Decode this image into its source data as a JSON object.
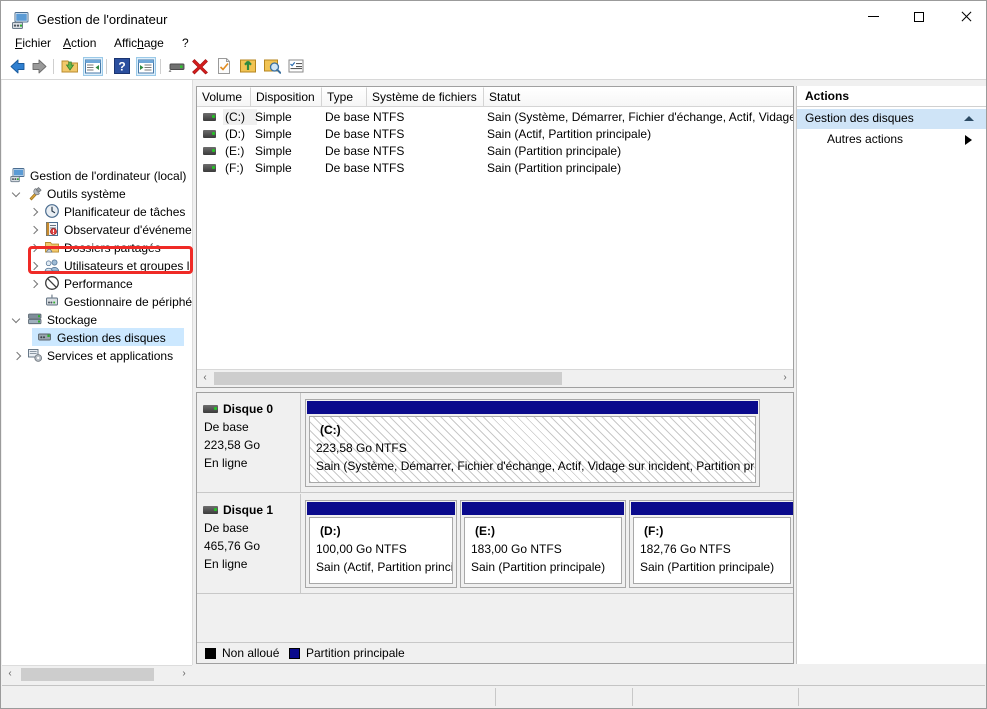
{
  "window": {
    "title": "Gestion de l'ordinateur",
    "icon": "computer-management-icon",
    "minimize": "—",
    "maximize": "□",
    "close": "✕"
  },
  "menubar": {
    "items": [
      {
        "label": "Fichier",
        "accel": "F"
      },
      {
        "label": "Action",
        "accel": "A"
      },
      {
        "label": "Affichage",
        "accel": "h"
      },
      {
        "label": "?",
        "accel": "?"
      }
    ]
  },
  "toolbar": {
    "buttons": [
      {
        "name": "back-icon",
        "tip": "Précédent"
      },
      {
        "name": "forward-icon",
        "tip": "Suivant"
      },
      {
        "name": "up-folder-icon",
        "tip": "Remonter d'un niveau"
      },
      {
        "name": "show-hide-console-tree-icon",
        "tip": "Afficher/Masquer l'arborescence"
      },
      {
        "name": "help-icon",
        "tip": "Aide"
      },
      {
        "name": "show-action-pane-icon",
        "tip": "Afficher le volet Actions"
      },
      {
        "name": "disk-icon",
        "tip": "Disque"
      },
      {
        "name": "delete-red-x-icon",
        "tip": "Supprimer"
      },
      {
        "name": "properties-icon",
        "tip": "Propriétés"
      },
      {
        "name": "export-list-icon",
        "tip": "Exporter la liste"
      },
      {
        "name": "scan-icon",
        "tip": "Analyser"
      },
      {
        "name": "task-list-icon",
        "tip": "Liste des tâches"
      }
    ]
  },
  "tree": {
    "root": "Gestion de l'ordinateur (local)",
    "nodes": [
      {
        "label": "Gestion de l'ordinateur (local)",
        "level": 0,
        "icon": "computer-icon",
        "expander": "none",
        "selected": false
      },
      {
        "label": "Outils système",
        "level": 1,
        "icon": "tools-icon",
        "expander": "open",
        "selected": false
      },
      {
        "label": "Planificateur de tâches",
        "level": 2,
        "icon": "clock-icon",
        "expander": "closed",
        "selected": false
      },
      {
        "label": "Observateur d'événeme",
        "level": 2,
        "icon": "event-viewer-icon",
        "expander": "closed",
        "selected": false
      },
      {
        "label": "Dossiers partagés",
        "level": 2,
        "icon": "shared-folder-icon",
        "expander": "closed",
        "selected": false
      },
      {
        "label": "Utilisateurs et groupes l",
        "level": 2,
        "icon": "users-groups-icon",
        "expander": "closed",
        "selected": false
      },
      {
        "label": "Performance",
        "level": 2,
        "icon": "performance-icon",
        "expander": "closed",
        "selected": false
      },
      {
        "label": "Gestionnaire de périphé",
        "level": 2,
        "icon": "device-manager-icon",
        "expander": "none",
        "selected": false
      },
      {
        "label": "Stockage",
        "level": 1,
        "icon": "storage-icon",
        "expander": "open",
        "selected": false
      },
      {
        "label": "Gestion des disques",
        "level": 2,
        "icon": "disk-management-icon",
        "expander": "none",
        "selected": true
      },
      {
        "label": "Services et applications",
        "level": 1,
        "icon": "services-icon",
        "expander": "closed",
        "selected": false
      }
    ]
  },
  "volume_list": {
    "columns": [
      "Volume",
      "Disposition",
      "Type",
      "Système de fichiers",
      "Statut"
    ],
    "rows": [
      {
        "volume": "(C:)",
        "disposition": "Simple",
        "type": "De base",
        "filesystem": "NTFS",
        "status": "Sain (Système, Démarrer, Fichier d'échange, Actif, Vidage",
        "selected": true
      },
      {
        "volume": "(D:)",
        "disposition": "Simple",
        "type": "De base",
        "filesystem": "NTFS",
        "status": "Sain (Actif, Partition principale)",
        "selected": false
      },
      {
        "volume": "(E:)",
        "disposition": "Simple",
        "type": "De base",
        "filesystem": "NTFS",
        "status": "Sain (Partition principale)",
        "selected": false
      },
      {
        "volume": "(F:)",
        "disposition": "Simple",
        "type": "De base",
        "filesystem": "NTFS",
        "status": "Sain (Partition principale)",
        "selected": false
      }
    ],
    "scroll_left_arrow": "‹",
    "scroll_right_arrow": "›"
  },
  "graphical_view": {
    "disks": [
      {
        "name": "Disque 0",
        "type": "De base",
        "size": "223,58 Go",
        "state": "En ligne",
        "partitions": [
          {
            "label": "(C:)",
            "size": "223,58 Go NTFS",
            "status": "Sain (Système, Démarrer, Fichier d'échange, Actif, Vidage sur incident, Partition princ",
            "style": "hatched",
            "bar_color": "#0a0a8c"
          }
        ]
      },
      {
        "name": "Disque 1",
        "type": "De base",
        "size": "465,76 Go",
        "state": "En ligne",
        "partitions": [
          {
            "label": "(D:)",
            "size": "100,00 Go NTFS",
            "status": "Sain (Actif, Partition princi",
            "style": "plain",
            "bar_color": "#0a0a8c"
          },
          {
            "label": "(E:)",
            "size": "183,00 Go NTFS",
            "status": "Sain (Partition principale)",
            "style": "plain",
            "bar_color": "#0a0a8c"
          },
          {
            "label": "(F:)",
            "size": "182,76 Go NTFS",
            "status": "Sain (Partition principale)",
            "style": "plain",
            "bar_color": "#0a0a8c"
          }
        ]
      }
    ],
    "legend": [
      {
        "label": "Non alloué",
        "color": "#000000"
      },
      {
        "label": "Partition principale",
        "color": "#0a0a8c"
      }
    ]
  },
  "actions_pane": {
    "title": "Actions",
    "group": "Gestion des disques",
    "items": [
      {
        "label": "Autres actions",
        "has_submenu": true
      }
    ]
  },
  "tree_scroll": {
    "left_arrow": "‹",
    "right_arrow": "›"
  },
  "annotation": {
    "target": "Gestion des disques",
    "color": "#ef2a26"
  }
}
